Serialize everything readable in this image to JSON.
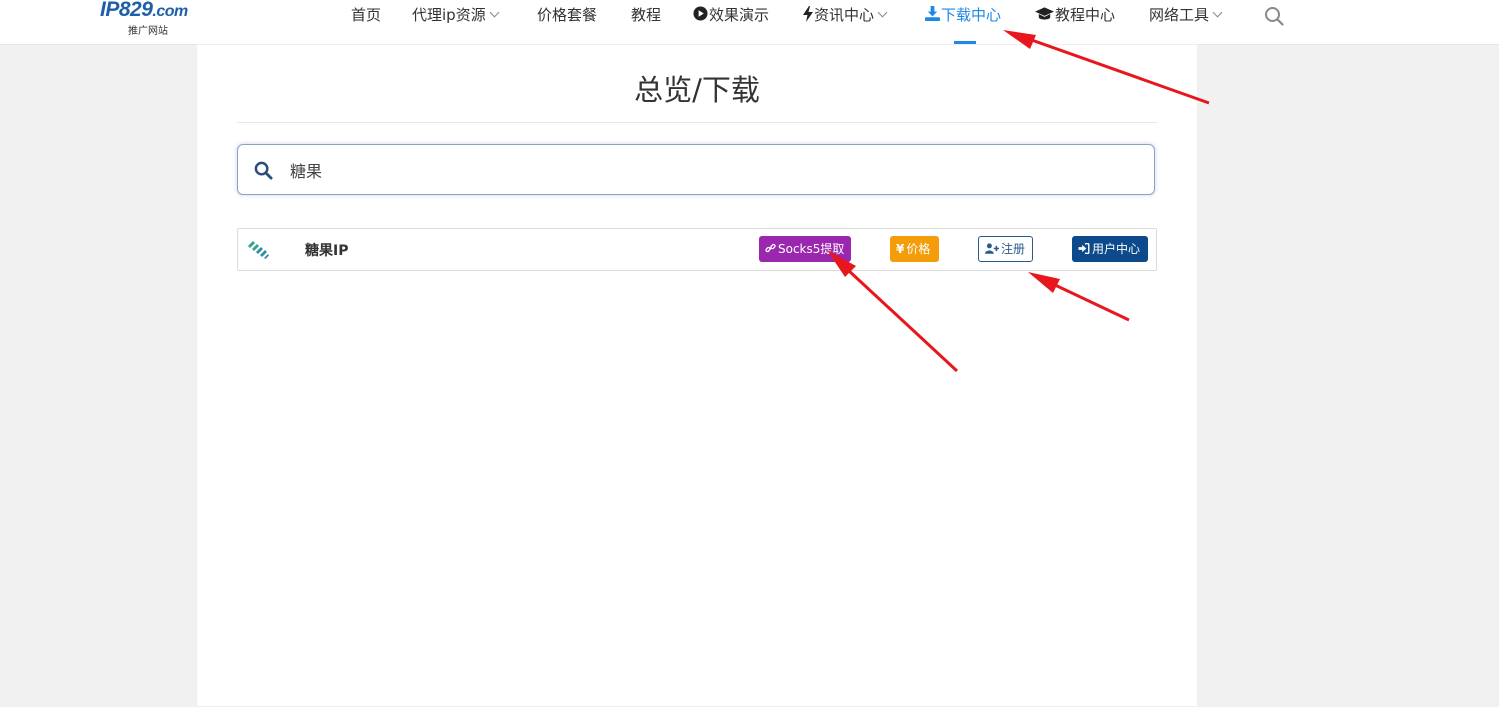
{
  "logo": {
    "main": "IP829",
    "domain": ".com",
    "sub": "推广网站"
  },
  "nav": {
    "items": [
      {
        "label": "首页"
      },
      {
        "label": "代理ip资源"
      },
      {
        "label": "价格套餐"
      },
      {
        "label": "教程"
      },
      {
        "label": "效果演示"
      },
      {
        "label": "资讯中心"
      },
      {
        "label": "下载中心"
      },
      {
        "label": "教程中心"
      },
      {
        "label": "网络工具"
      }
    ],
    "active": "下载中心"
  },
  "page": {
    "title": "总览/下载"
  },
  "search": {
    "value": "糖果"
  },
  "results": [
    {
      "name": "糖果IP",
      "buttons": {
        "socks": "Socks5提取",
        "price": "价格",
        "register": "注册",
        "user_center": "用户中心"
      }
    }
  ],
  "colors": {
    "accent": "#1e88e5",
    "socks": "#9b27af",
    "price": "#f59c0b",
    "register_border": "#2a5a8c",
    "user_center": "#0d4a8c",
    "annotation": "#e8171e"
  }
}
